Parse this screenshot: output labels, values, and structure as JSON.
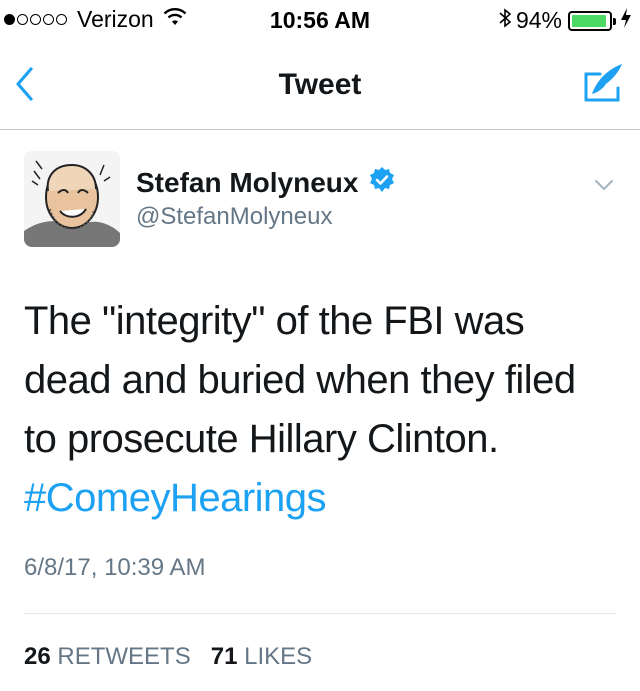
{
  "status_bar": {
    "carrier": "Verizon",
    "time": "10:56 AM",
    "battery_percent": "94%",
    "battery_level": 0.94,
    "signal_bars_filled": 1,
    "signal_bars_total": 5
  },
  "nav": {
    "title": "Tweet",
    "back_icon": "chevron-left-icon",
    "compose_icon": "compose-tweet-icon",
    "accent_color": "#1da1f2"
  },
  "tweet": {
    "author_name": "Stefan Molyneux",
    "author_handle": "@StefanMolyneux",
    "verified": true,
    "text_lines": [
      "The \"integrity\" of the FBI was",
      "dead and buried when they filed",
      "to prosecute Hillary Clinton."
    ],
    "hashtag": "#ComeyHearings",
    "timestamp": "6/8/17, 10:39 AM",
    "retweets_count": "26",
    "retweets_label": "RETWEETS",
    "likes_count": "71",
    "likes_label": "LIKES"
  }
}
